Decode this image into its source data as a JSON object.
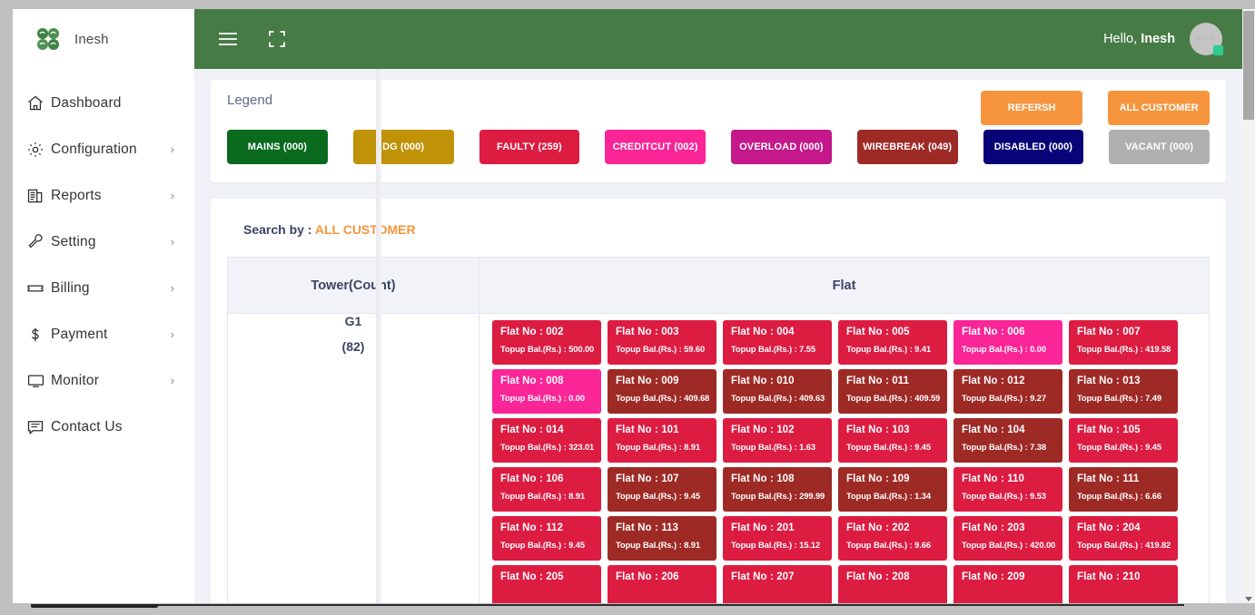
{
  "brand": {
    "name": "Inesh",
    "logo_icon": "clover-logo-icon"
  },
  "sidebar": {
    "items": [
      {
        "label": "Dashboard",
        "icon": "home-icon",
        "has_arrow": false
      },
      {
        "label": "Configuration",
        "icon": "gear-icon",
        "has_arrow": true
      },
      {
        "label": "Reports",
        "icon": "report-icon",
        "has_arrow": true
      },
      {
        "label": "Setting",
        "icon": "wrench-icon",
        "has_arrow": true
      },
      {
        "label": "Billing",
        "icon": "ticket-icon",
        "has_arrow": true
      },
      {
        "label": "Payment",
        "icon": "dollar-icon",
        "has_arrow": true
      },
      {
        "label": "Monitor",
        "icon": "monitor-icon",
        "has_arrow": true
      },
      {
        "label": "Contact Us",
        "icon": "message-icon",
        "has_arrow": false
      }
    ]
  },
  "topbar": {
    "menu_icon": "hamburger-icon",
    "fullscreen_icon": "fullscreen-icon",
    "greeting": "Hello,",
    "user": "Inesh",
    "avatar_initials": "USER",
    "brand_color": "#467b45",
    "status_color": "#2ecc8f"
  },
  "legend": {
    "title": "Legend",
    "buttons": [
      {
        "label": "MAINS (000)",
        "color": "#0a6b1f"
      },
      {
        "label": "DG (000)",
        "color": "#bf9207"
      },
      {
        "label": "FAULTY (259)",
        "color": "#dd1c42"
      },
      {
        "label": "CREDITCUT (002)",
        "color": "#fa2596"
      },
      {
        "label": "OVERLOAD (000)",
        "color": "#c4188b"
      },
      {
        "label": "WIREBREAK (049)",
        "color": "#9e2a26"
      },
      {
        "label": "DISABLED (000)",
        "color": "#070477"
      },
      {
        "label": "VACANT (000)",
        "color": "#b0b0b0"
      }
    ],
    "actions": [
      {
        "label": "REFERSH",
        "color": "#f6953e"
      },
      {
        "label": "ALL CUSTOMER",
        "color": "#f6953e"
      }
    ]
  },
  "search": {
    "label": "Search by :",
    "value": "ALL CUSTOMER",
    "accent_color": "#f6953e"
  },
  "table": {
    "headers": {
      "tower": "Tower(Count)",
      "flat": "Flat"
    },
    "tower": {
      "name": "G1",
      "count": "(82)"
    },
    "balance_prefix": "Topup Bal.(Rs.) :",
    "flat_prefix": "Flat No :",
    "flats": [
      {
        "no": "002",
        "bal": "500.00",
        "color": "#dd1c42"
      },
      {
        "no": "003",
        "bal": "59.60",
        "color": "#dd1c42"
      },
      {
        "no": "004",
        "bal": "7.55",
        "color": "#dd1c42"
      },
      {
        "no": "005",
        "bal": "9.41",
        "color": "#dd1c42"
      },
      {
        "no": "006",
        "bal": "0.00",
        "color": "#fa2596"
      },
      {
        "no": "007",
        "bal": "419.58",
        "color": "#dd1c42"
      },
      {
        "no": "008",
        "bal": "0.00",
        "color": "#fa2596"
      },
      {
        "no": "009",
        "bal": "409.68",
        "color": "#9e2a26"
      },
      {
        "no": "010",
        "bal": "409.63",
        "color": "#9e2a26"
      },
      {
        "no": "011",
        "bal": "409.59",
        "color": "#9e2a26"
      },
      {
        "no": "012",
        "bal": "9.27",
        "color": "#9e2a26"
      },
      {
        "no": "013",
        "bal": "7.49",
        "color": "#9e2a26"
      },
      {
        "no": "014",
        "bal": "323.01",
        "color": "#dd1c42"
      },
      {
        "no": "101",
        "bal": "8.91",
        "color": "#dd1c42"
      },
      {
        "no": "102",
        "bal": "1.63",
        "color": "#dd1c42"
      },
      {
        "no": "103",
        "bal": "9.45",
        "color": "#dd1c42"
      },
      {
        "no": "104",
        "bal": "7.38",
        "color": "#9e2a26"
      },
      {
        "no": "105",
        "bal": "9.45",
        "color": "#dd1c42"
      },
      {
        "no": "106",
        "bal": "8.91",
        "color": "#dd1c42"
      },
      {
        "no": "107",
        "bal": "9.45",
        "color": "#9e2a26"
      },
      {
        "no": "108",
        "bal": "299.99",
        "color": "#9e2a26"
      },
      {
        "no": "109",
        "bal": "1.34",
        "color": "#9e2a26"
      },
      {
        "no": "110",
        "bal": "9.53",
        "color": "#dd1c42"
      },
      {
        "no": "111",
        "bal": "6.66",
        "color": "#9e2a26"
      },
      {
        "no": "112",
        "bal": "9.45",
        "color": "#dd1c42"
      },
      {
        "no": "113",
        "bal": "8.91",
        "color": "#9e2a26"
      },
      {
        "no": "201",
        "bal": "15.12",
        "color": "#dd1c42"
      },
      {
        "no": "202",
        "bal": "9.66",
        "color": "#dd1c42"
      },
      {
        "no": "203",
        "bal": "420.00",
        "color": "#dd1c42"
      },
      {
        "no": "204",
        "bal": "419.82",
        "color": "#dd1c42"
      },
      {
        "no": "205",
        "bal": "",
        "color": "#dd1c42"
      },
      {
        "no": "206",
        "bal": "",
        "color": "#dd1c42"
      },
      {
        "no": "207",
        "bal": "",
        "color": "#dd1c42"
      },
      {
        "no": "208",
        "bal": "",
        "color": "#dd1c42"
      },
      {
        "no": "209",
        "bal": "",
        "color": "#dd1c42"
      },
      {
        "no": "210",
        "bal": "",
        "color": "#dd1c42"
      }
    ]
  }
}
